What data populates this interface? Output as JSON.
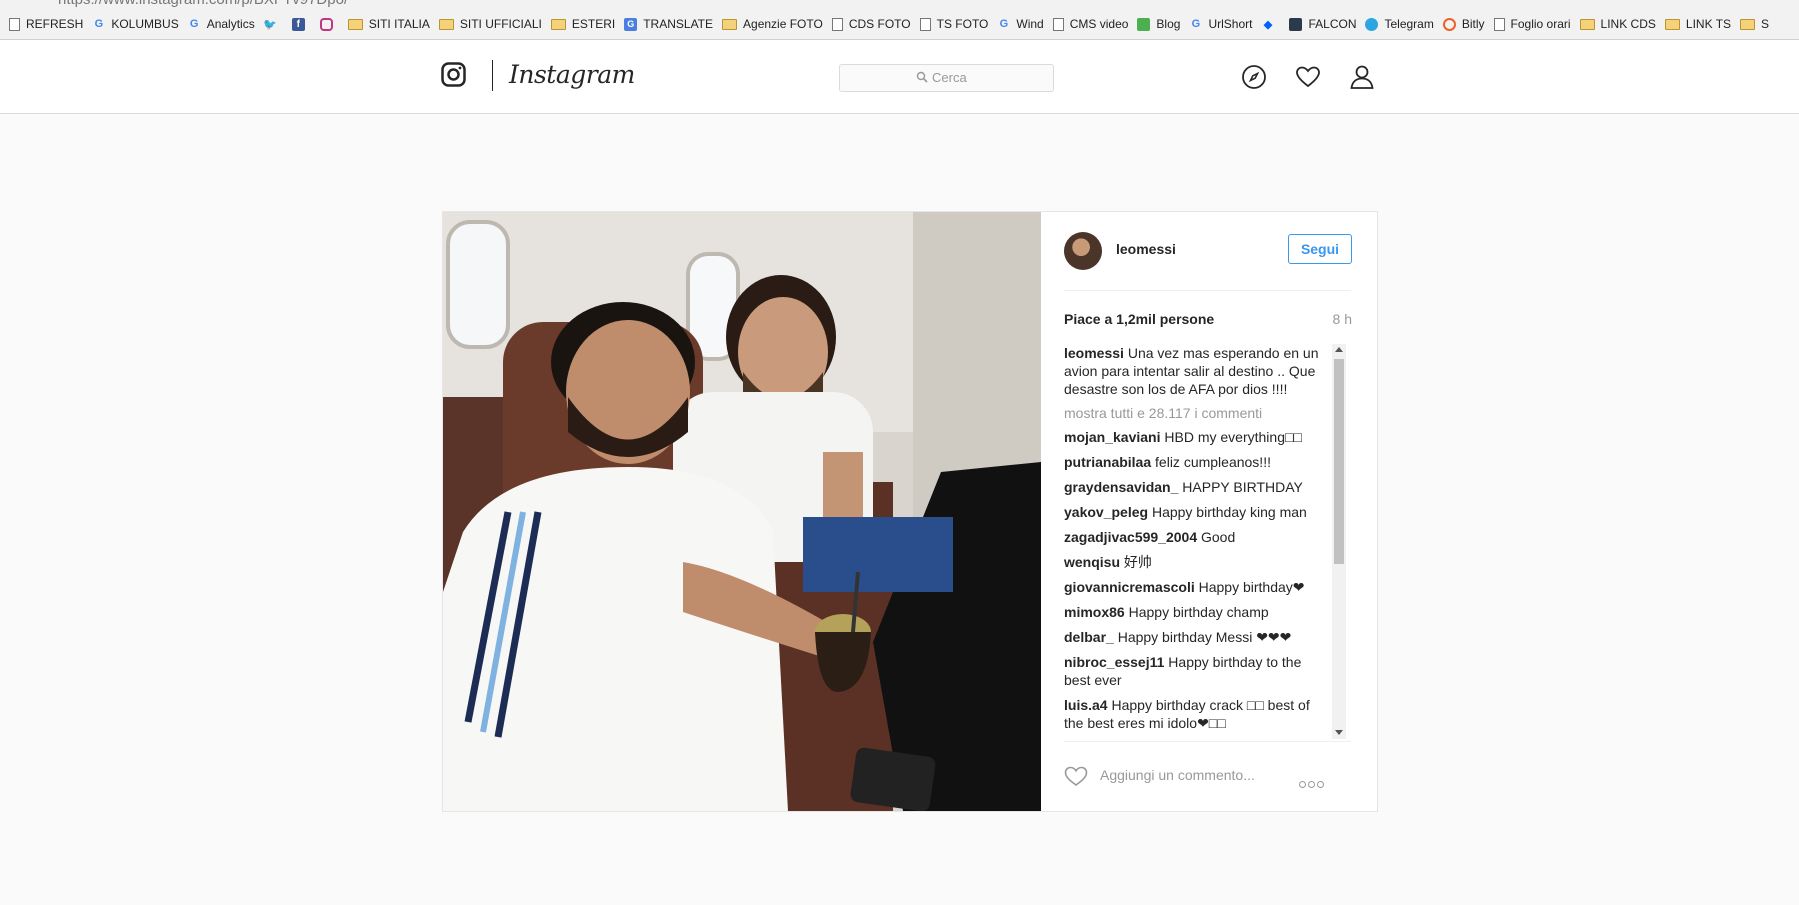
{
  "browser": {
    "url_prefix": "https://www.instagram.com",
    "url_suffix": "/p/BXFTv97Dpo/",
    "bookmarks": [
      {
        "icon": "page",
        "label": "REFRESH"
      },
      {
        "icon": "g",
        "label": "KOLUMBUS"
      },
      {
        "icon": "g",
        "label": "Analytics"
      },
      {
        "icon": "tw",
        "label": ""
      },
      {
        "icon": "fb",
        "label": ""
      },
      {
        "icon": "ig",
        "label": ""
      },
      {
        "icon": "folder",
        "label": "SITI ITALIA"
      },
      {
        "icon": "folder",
        "label": "SITI UFFICIALI"
      },
      {
        "icon": "folder",
        "label": "ESTERI"
      },
      {
        "icon": "tr",
        "label": "TRANSLATE"
      },
      {
        "icon": "folder",
        "label": "Agenzie FOTO"
      },
      {
        "icon": "page",
        "label": "CDS FOTO"
      },
      {
        "icon": "page",
        "label": "TS FOTO"
      },
      {
        "icon": "g",
        "label": "Wind"
      },
      {
        "icon": "page",
        "label": "CMS video"
      },
      {
        "icon": "blog",
        "label": "Blog"
      },
      {
        "icon": "g",
        "label": "UrlShort"
      },
      {
        "icon": "db",
        "label": ""
      },
      {
        "icon": "fal",
        "label": "FALCON"
      },
      {
        "icon": "tg",
        "label": "Telegram"
      },
      {
        "icon": "bt",
        "label": "Bitly"
      },
      {
        "icon": "page",
        "label": "Foglio orari"
      },
      {
        "icon": "folder",
        "label": "LINK CDS"
      },
      {
        "icon": "folder",
        "label": "LINK TS"
      },
      {
        "icon": "folder",
        "label": "S"
      }
    ]
  },
  "header": {
    "logo_text": "Instagram",
    "search_placeholder": "Cerca",
    "icons": [
      "compass-icon",
      "heart-icon",
      "profile-icon"
    ]
  },
  "post": {
    "username": "leomessi",
    "follow_label": "Segui",
    "likes": "Piace a 1,2mil persone",
    "time": "8 h",
    "caption_user": "leomessi",
    "caption_text": "Una vez mas esperando en un avion para intentar salir al destino .. Que desastre son los de AFA por dios !!!!",
    "show_all": "mostra tutti e 28.117 i commenti",
    "comments": [
      {
        "user": "mojan_kaviani",
        "text": "HBD my everything□□"
      },
      {
        "user": "putrianabilaa",
        "text": "feliz cumpleanos!!!"
      },
      {
        "user": "graydensavidan_",
        "text": "HAPPY BIRTHDAY"
      },
      {
        "user": "yakov_peleg",
        "text": "Happy birthday king man"
      },
      {
        "user": "zagadjivac599_2004",
        "text": "Good"
      },
      {
        "user": "wenqisu",
        "text": "好帅"
      },
      {
        "user": "giovannicremascoli",
        "text": "Happy birthday❤"
      },
      {
        "user": "mimox86",
        "text": "Happy birthday champ"
      },
      {
        "user": "delbar_",
        "text": "Happy birthday Messi ❤❤❤"
      },
      {
        "user": "nibroc_essej11",
        "text": "Happy birthday to the best ever"
      },
      {
        "user": "luis.a4",
        "text": "Happy birthday crack □□ best of the best eres mi idolo❤□□"
      }
    ],
    "add_comment_placeholder": "Aggiungi un commento..."
  }
}
